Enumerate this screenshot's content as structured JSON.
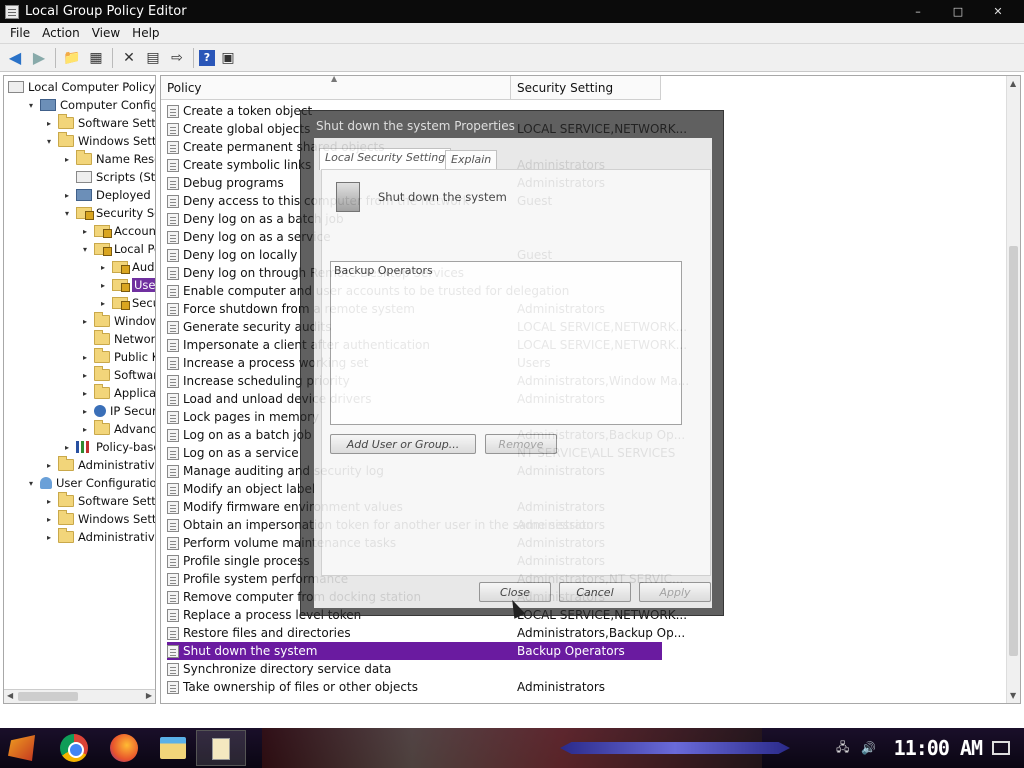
{
  "window": {
    "title": "Local Group Policy Editor",
    "controls": [
      "–",
      "□",
      "✕"
    ]
  },
  "menu": [
    "File",
    "Action",
    "View",
    "Help"
  ],
  "toolbar": {
    "icons": [
      "back-arrow-icon",
      "forward-arrow-icon",
      "up-folder-icon",
      "show-hide-tree-icon",
      "delete-icon",
      "properties-icon",
      "export-list-icon",
      "help-icon",
      "show-pane-icon"
    ]
  },
  "tree": [
    {
      "label": "Local Computer Policy",
      "level": 0,
      "exp": "",
      "icon": "policy"
    },
    {
      "label": "Computer Configuration",
      "level": 1,
      "exp": "▾",
      "icon": "computer"
    },
    {
      "label": "Software Settings",
      "level": 2,
      "exp": "▸",
      "icon": "folder"
    },
    {
      "label": "Windows Settings",
      "level": 2,
      "exp": "▾",
      "icon": "folder"
    },
    {
      "label": "Name Resolution Policy",
      "level": 3,
      "exp": "▸",
      "icon": "folder"
    },
    {
      "label": "Scripts (Startup/Shutdown)",
      "level": 3,
      "exp": "",
      "icon": "script"
    },
    {
      "label": "Deployed Printers",
      "level": 3,
      "exp": "▸",
      "icon": "computer"
    },
    {
      "label": "Security Settings",
      "level": 3,
      "exp": "▾",
      "icon": "lockfolder"
    },
    {
      "label": "Account Policies",
      "level": 4,
      "exp": "▸",
      "icon": "lockfolder"
    },
    {
      "label": "Local Policies",
      "level": 4,
      "exp": "▾",
      "icon": "lockfolder"
    },
    {
      "label": "Audit Policy",
      "level": 5,
      "exp": "▸",
      "icon": "lockfolder"
    },
    {
      "label": "User Rights Assignment",
      "level": 5,
      "exp": "▸",
      "icon": "lockfolder",
      "selected": true
    },
    {
      "label": "Security Options",
      "level": 5,
      "exp": "▸",
      "icon": "lockfolder"
    },
    {
      "label": "Windows Firewall",
      "level": 4,
      "exp": "▸",
      "icon": "folder"
    },
    {
      "label": "Network List Manager",
      "level": 4,
      "exp": "",
      "icon": "folder"
    },
    {
      "label": "Public Key Policies",
      "level": 4,
      "exp": "▸",
      "icon": "folder"
    },
    {
      "label": "Software Restriction",
      "level": 4,
      "exp": "▸",
      "icon": "folder"
    },
    {
      "label": "Application Control",
      "level": 4,
      "exp": "▸",
      "icon": "folder"
    },
    {
      "label": "IP Security Policies",
      "level": 4,
      "exp": "▸",
      "icon": "ipsec"
    },
    {
      "label": "Advanced Audit",
      "level": 4,
      "exp": "▸",
      "icon": "folder"
    },
    {
      "label": "Policy-based QoS",
      "level": 3,
      "exp": "▸",
      "icon": "chart"
    },
    {
      "label": "Administrative Templates",
      "level": 2,
      "exp": "▸",
      "icon": "folder"
    },
    {
      "label": "User Configuration",
      "level": 1,
      "exp": "▾",
      "icon": "user"
    },
    {
      "label": "Software Settings",
      "level": 2,
      "exp": "▸",
      "icon": "folder"
    },
    {
      "label": "Windows Settings",
      "level": 2,
      "exp": "▸",
      "icon": "folder"
    },
    {
      "label": "Administrative Templates",
      "level": 2,
      "exp": "▸",
      "icon": "folder"
    }
  ],
  "list": {
    "columns": [
      "Policy",
      "Security Setting"
    ],
    "rows": [
      {
        "policy": "Create a token object",
        "setting": ""
      },
      {
        "policy": "Create global objects",
        "setting": "LOCAL SERVICE,NETWORK..."
      },
      {
        "policy": "Create permanent shared objects",
        "setting": ""
      },
      {
        "policy": "Create symbolic links",
        "setting": "Administrators"
      },
      {
        "policy": "Debug programs",
        "setting": "Administrators"
      },
      {
        "policy": "Deny access to this computer from the network",
        "setting": "Guest"
      },
      {
        "policy": "Deny log on as a batch job",
        "setting": ""
      },
      {
        "policy": "Deny log on as a service",
        "setting": ""
      },
      {
        "policy": "Deny log on locally",
        "setting": "Guest"
      },
      {
        "policy": "Deny log on through Remote Desktop Services",
        "setting": ""
      },
      {
        "policy": "Enable computer and user accounts to be trusted for delegation",
        "setting": ""
      },
      {
        "policy": "Force shutdown from a remote system",
        "setting": "Administrators"
      },
      {
        "policy": "Generate security audits",
        "setting": "LOCAL SERVICE,NETWORK..."
      },
      {
        "policy": "Impersonate a client after authentication",
        "setting": "LOCAL SERVICE,NETWORK..."
      },
      {
        "policy": "Increase a process working set",
        "setting": "Users"
      },
      {
        "policy": "Increase scheduling priority",
        "setting": "Administrators,Window Ma..."
      },
      {
        "policy": "Load and unload device drivers",
        "setting": "Administrators"
      },
      {
        "policy": "Lock pages in memory",
        "setting": ""
      },
      {
        "policy": "Log on as a batch job",
        "setting": "Administrators,Backup Op..."
      },
      {
        "policy": "Log on as a service",
        "setting": "NT SERVICE\\ALL SERVICES"
      },
      {
        "policy": "Manage auditing and security log",
        "setting": "Administrators"
      },
      {
        "policy": "Modify an object label",
        "setting": ""
      },
      {
        "policy": "Modify firmware environment values",
        "setting": "Administrators"
      },
      {
        "policy": "Obtain an impersonation token for another user in the same session",
        "setting": "Administrators"
      },
      {
        "policy": "Perform volume maintenance tasks",
        "setting": "Administrators"
      },
      {
        "policy": "Profile single process",
        "setting": "Administrators"
      },
      {
        "policy": "Profile system performance",
        "setting": "Administrators,NT SERVIC..."
      },
      {
        "policy": "Remove computer from docking station",
        "setting": "Administrators"
      },
      {
        "policy": "Replace a process level token",
        "setting": "LOCAL SERVICE,NETWORK..."
      },
      {
        "policy": "Restore files and directories",
        "setting": "Administrators,Backup Op..."
      },
      {
        "policy": "Shut down the system",
        "setting": "Backup Operators",
        "selected": true
      },
      {
        "policy": "Synchronize directory service data",
        "setting": ""
      },
      {
        "policy": "Take ownership of files or other objects",
        "setting": "Administrators"
      }
    ]
  },
  "dialog": {
    "title": "Shut down the system Properties",
    "tabs": [
      "Local Security Setting",
      "Explain"
    ],
    "policy_name": "Shut down the system",
    "members": [
      "Backup Operators"
    ],
    "buttons": {
      "add": "Add User or Group...",
      "remove": "Remove",
      "close": "Close",
      "cancel": "Cancel",
      "apply": "Apply"
    }
  },
  "taskbar": {
    "clock": "11:00 AM",
    "apps": [
      "start-icon",
      "chrome-icon",
      "firefox-icon",
      "file-explorer-icon",
      "group-policy-taskbar-item"
    ]
  }
}
